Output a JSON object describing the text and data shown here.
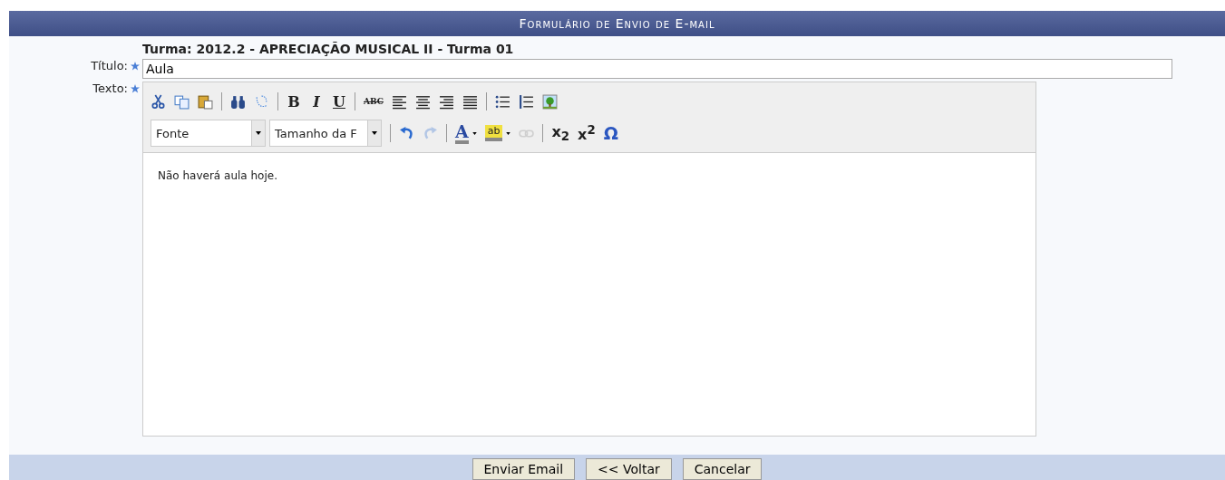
{
  "header": {
    "title": "Formulário de Envio de E-mail"
  },
  "form": {
    "class_line": "Turma: 2012.2 - APRECIAÇÃO MUSICAL II - Turma 01",
    "title_label": "Título:",
    "title_value": "Aula",
    "text_label": "Texto:",
    "toolbar_row_1": [
      {
        "kind": "cut",
        "disabled": false
      },
      {
        "kind": "copy",
        "disabled": false
      },
      {
        "kind": "paste",
        "disabled": false
      },
      {
        "kind": "sep"
      },
      {
        "kind": "find",
        "disabled": false
      },
      {
        "kind": "replace",
        "disabled": false
      },
      {
        "kind": "sep"
      },
      {
        "kind": "bold",
        "glyph": "B",
        "disabled": false
      },
      {
        "kind": "italic",
        "glyph": "I",
        "disabled": false
      },
      {
        "kind": "underline",
        "glyph": "U",
        "disabled": false
      },
      {
        "kind": "sep"
      },
      {
        "kind": "strike",
        "glyph": "ABC",
        "disabled": false
      },
      {
        "kind": "align-left",
        "disabled": false
      },
      {
        "kind": "align-center",
        "disabled": false
      },
      {
        "kind": "align-right",
        "disabled": false
      },
      {
        "kind": "justify",
        "disabled": false
      },
      {
        "kind": "sep"
      },
      {
        "kind": "bullets",
        "disabled": false
      },
      {
        "kind": "numbers",
        "disabled": false
      },
      {
        "kind": "image",
        "disabled": false
      }
    ],
    "toolbar_row_2": [
      {
        "kind": "select",
        "label": "Fonte"
      },
      {
        "kind": "select",
        "label": "Tamanho da F"
      },
      {
        "kind": "sep"
      },
      {
        "kind": "undo",
        "disabled": false
      },
      {
        "kind": "redo",
        "disabled": true
      },
      {
        "kind": "sep"
      },
      {
        "kind": "text-color",
        "glyph": "A",
        "disabled": false
      },
      {
        "kind": "highlight",
        "glyph": "ab",
        "disabled": false
      },
      {
        "kind": "link",
        "disabled": true
      },
      {
        "kind": "sep"
      },
      {
        "kind": "subscript",
        "glyph": "x$_{2}$",
        "disabled": false
      },
      {
        "kind": "superscript",
        "glyph": "x$^{2}$",
        "disabled": false
      },
      {
        "kind": "omega",
        "glyph": "Ω",
        "disabled": false
      }
    ],
    "body_text": "Não haverá aula hoje."
  },
  "buttons": [
    "Enviar Email",
    "<< Voltar",
    "Cancelar"
  ]
}
